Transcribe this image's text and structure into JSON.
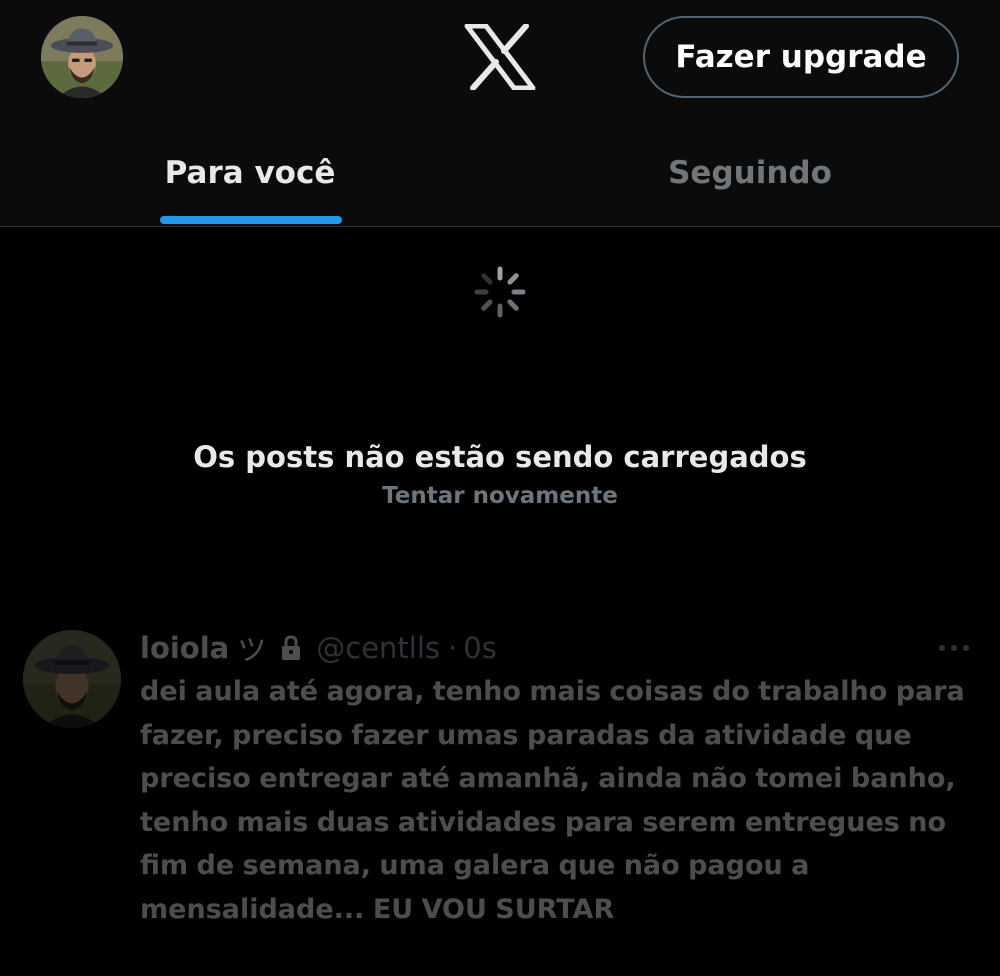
{
  "header": {
    "avatar_icon": "profile-avatar",
    "logo_icon": "x-logo-icon",
    "upgrade_label": "Fazer upgrade"
  },
  "tabs": [
    {
      "label": "Para você",
      "active": true
    },
    {
      "label": "Seguindo",
      "active": false
    }
  ],
  "status": {
    "spinner_icon": "loading-spinner-icon",
    "error_message": "Os posts não estão sendo carregados",
    "retry_label": "Tentar novamente"
  },
  "post": {
    "display_name": "loiola",
    "name_suffix": "ツ",
    "lock_icon": "lock-icon",
    "handle": "@centlls",
    "separator": "·",
    "time": "0s",
    "more_icon": "more-options-icon",
    "text": "dei aula até agora, tenho mais coisas do trabalho para fazer, preciso fazer umas paradas da atividade que preciso entregar até amanhã, ainda não tomei banho, tenho mais duas atividades para serem entregues no fim de semana, uma galera que não pagou a mensalidade... EU VOU SURTAR"
  },
  "colors": {
    "background": "#000000",
    "header_background": "#0b0b0c",
    "accent": "#1d9bf0",
    "text_primary": "#e7e9ea",
    "text_secondary": "#71767b"
  }
}
